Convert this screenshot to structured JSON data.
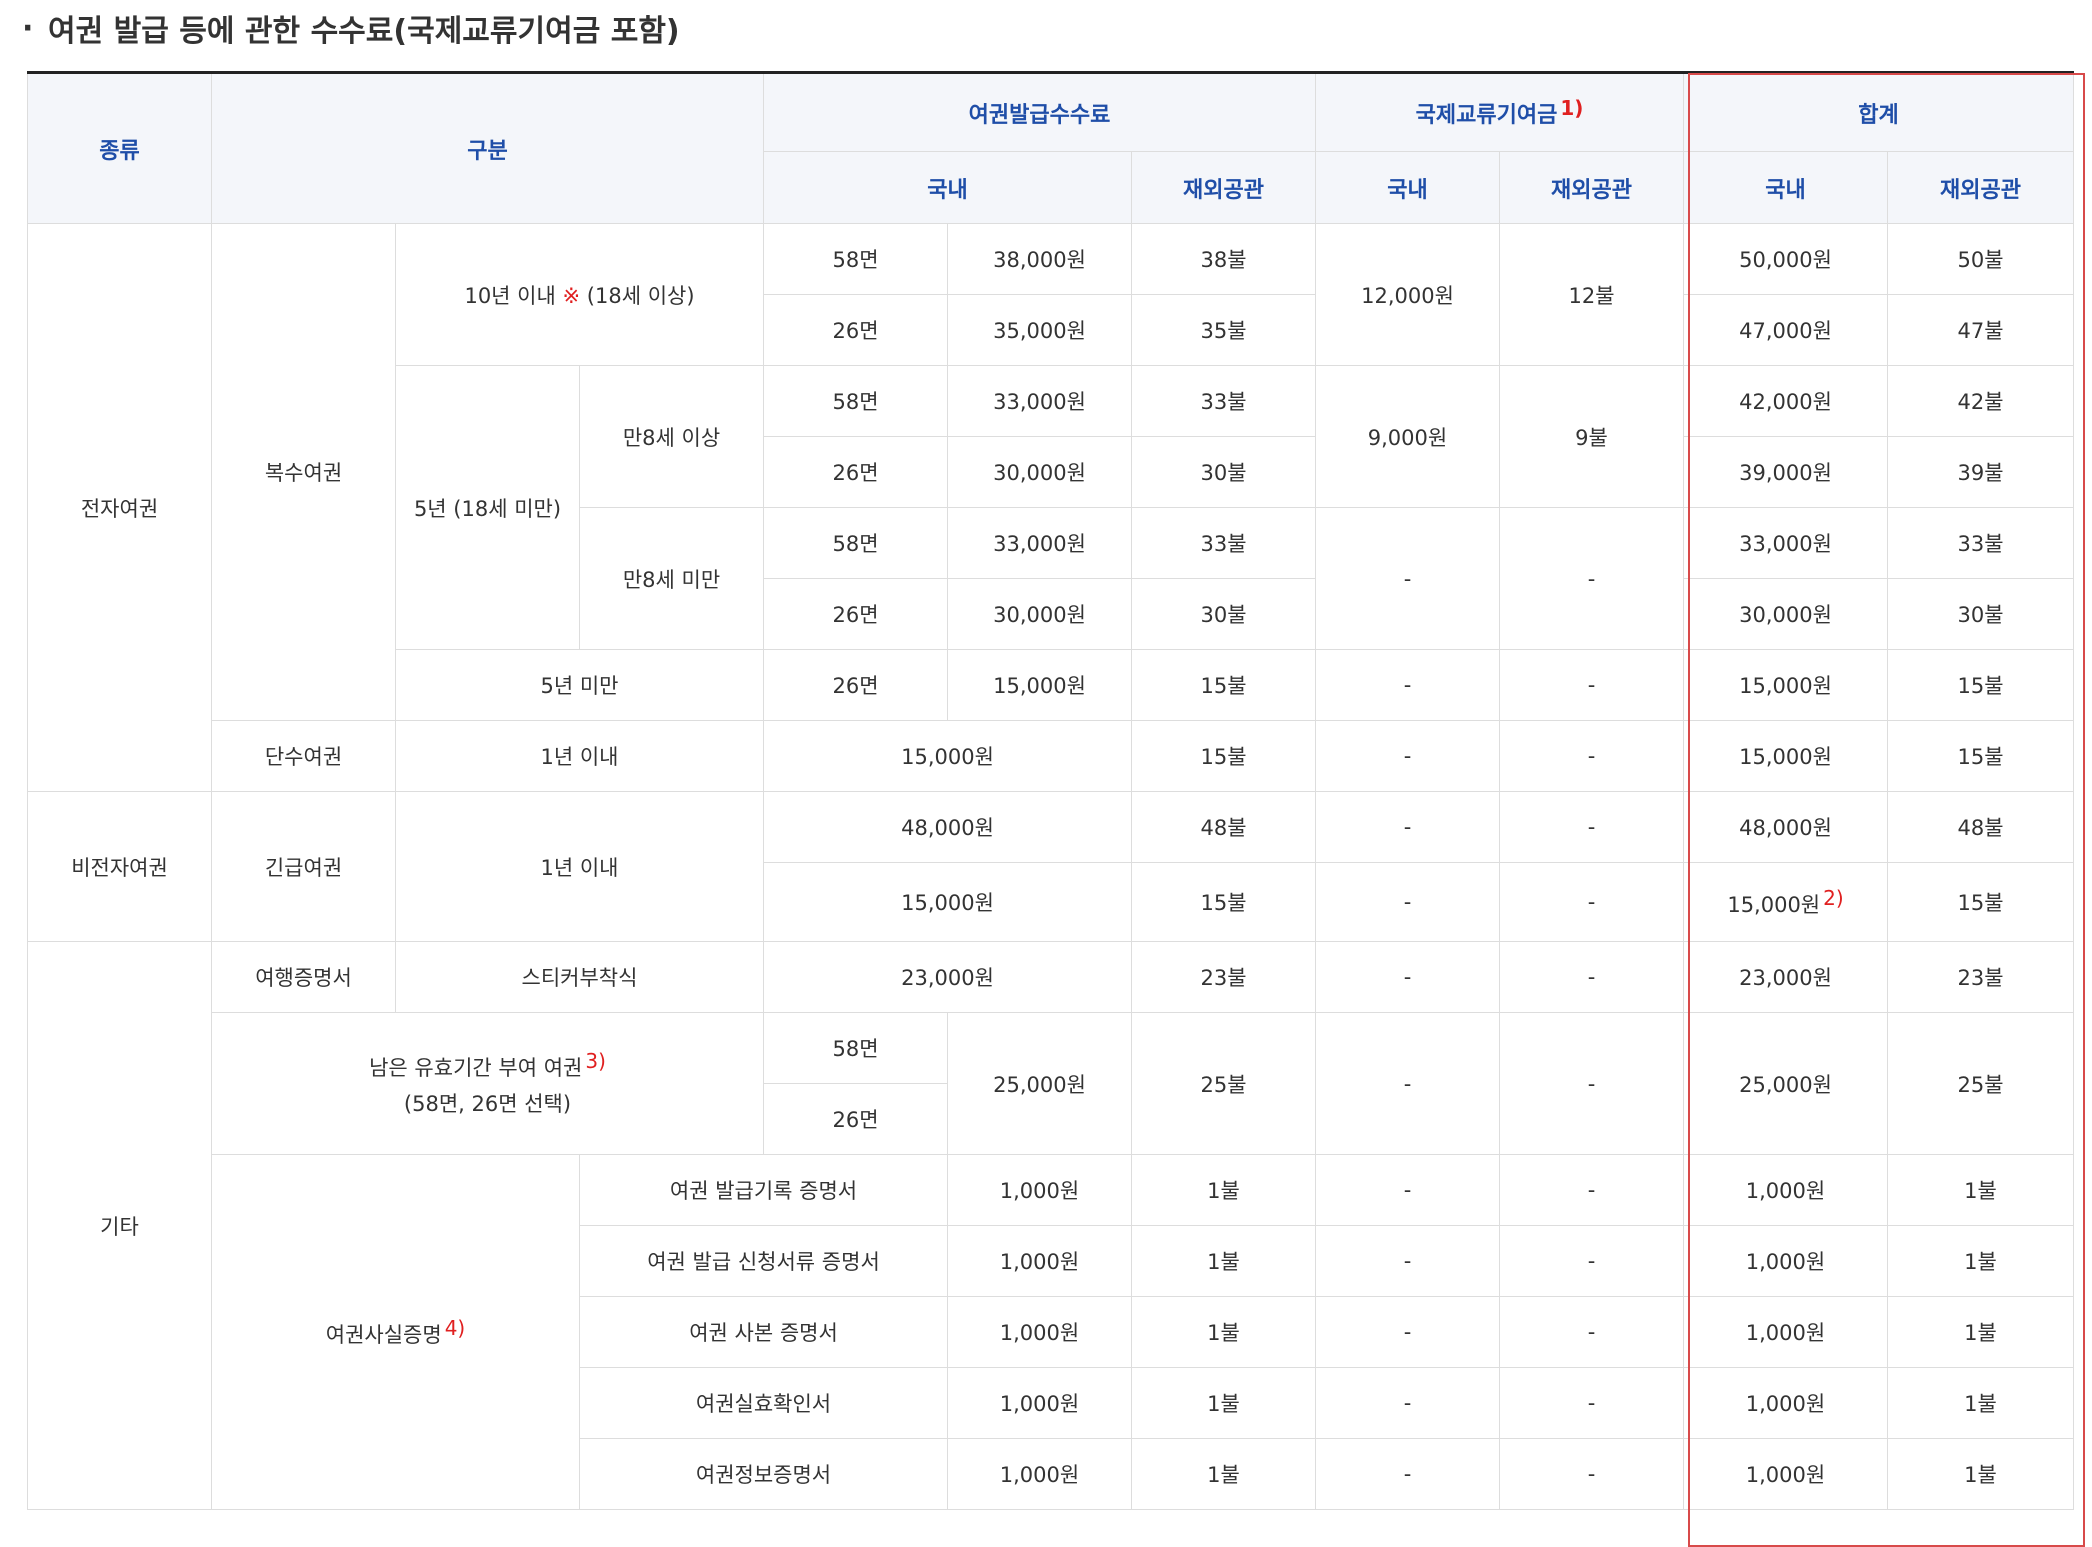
{
  "title": "여권 발급 등에 관한 수수료(국제교류기여금 포함)",
  "title_bullet": "·",
  "header": {
    "type": "종류",
    "category": "구분",
    "issuance_fee": "여권발급수수료",
    "contribution": "국제교류기여금",
    "contribution_note": "1)",
    "total": "합계",
    "domestic": "국내",
    "overseas": "재외공관"
  },
  "groups": {
    "electronic": "전자여권",
    "non_electronic": "비전자여권",
    "other": "기타"
  },
  "multi": {
    "label": "복수여권",
    "ten_year": "10년 이내",
    "ten_year_mark": "※",
    "ten_year_age": "(18세 이상)",
    "five_year": "5년 (18세 미만)",
    "age8_over": "만8세 이상",
    "age8_under": "만8세 미만",
    "under5": "5년 미만"
  },
  "pages": {
    "p58": "58면",
    "p26": "26면"
  },
  "rows": {
    "r1": {
      "dom": "38,000원",
      "ovs": "38불",
      "c_dom": "12,000원",
      "c_ovs": "12불",
      "t_dom": "50,000원",
      "t_ovs": "50불"
    },
    "r2": {
      "dom": "35,000원",
      "ovs": "35불",
      "t_dom": "47,000원",
      "t_ovs": "47불"
    },
    "r3": {
      "dom": "33,000원",
      "ovs": "33불",
      "c_dom": "9,000원",
      "c_ovs": "9불",
      "t_dom": "42,000원",
      "t_ovs": "42불"
    },
    "r4": {
      "dom": "30,000원",
      "ovs": "30불",
      "t_dom": "39,000원",
      "t_ovs": "39불"
    },
    "r5": {
      "dom": "33,000원",
      "ovs": "33불",
      "c_dom": "-",
      "c_ovs": "-",
      "t_dom": "33,000원",
      "t_ovs": "33불"
    },
    "r6": {
      "dom": "30,000원",
      "ovs": "30불",
      "t_dom": "30,000원",
      "t_ovs": "30불"
    },
    "r7": {
      "dom": "15,000원",
      "ovs": "15불",
      "c_dom": "-",
      "c_ovs": "-",
      "t_dom": "15,000원",
      "t_ovs": "15불"
    },
    "single": {
      "label": "단수여권",
      "period": "1년 이내",
      "dom": "15,000원",
      "ovs": "15불",
      "c_dom": "-",
      "c_ovs": "-",
      "t_dom": "15,000원",
      "t_ovs": "15불"
    },
    "emergency": {
      "label": "긴급여권",
      "period": "1년 이내"
    },
    "e1": {
      "dom": "48,000원",
      "ovs": "48불",
      "c_dom": "-",
      "c_ovs": "-",
      "t_dom": "48,000원",
      "t_ovs": "48불"
    },
    "e2": {
      "dom": "15,000원",
      "ovs": "15불",
      "c_dom": "-",
      "c_ovs": "-",
      "t_dom": "15,000원",
      "t_dom_note": "2)",
      "t_ovs": "15불"
    },
    "travel": {
      "label": "여행증명서",
      "type": "스티커부착식",
      "dom": "23,000원",
      "ovs": "23불",
      "c_dom": "-",
      "c_ovs": "-",
      "t_dom": "23,000원",
      "t_ovs": "23불"
    },
    "remaining": {
      "label": "남은 유효기간 부여 여권",
      "note": "3)",
      "sub": "(58면, 26면 선택)",
      "dom": "25,000원",
      "ovs": "25불",
      "c_dom": "-",
      "c_ovs": "-",
      "t_dom": "25,000원",
      "t_ovs": "25불"
    },
    "cert_label": "여권사실증명",
    "cert_note": "4)",
    "certs": [
      {
        "name": "여권 발급기록 증명서",
        "dom": "1,000원",
        "ovs": "1불",
        "c_dom": "-",
        "c_ovs": "-",
        "t_dom": "1,000원",
        "t_ovs": "1불"
      },
      {
        "name": "여권 발급 신청서류 증명서",
        "dom": "1,000원",
        "ovs": "1불",
        "c_dom": "-",
        "c_ovs": "-",
        "t_dom": "1,000원",
        "t_ovs": "1불"
      },
      {
        "name": "여권 사본 증명서",
        "dom": "1,000원",
        "ovs": "1불",
        "c_dom": "-",
        "c_ovs": "-",
        "t_dom": "1,000원",
        "t_ovs": "1불"
      },
      {
        "name": "여권실효확인서",
        "dom": "1,000원",
        "ovs": "1불",
        "c_dom": "-",
        "c_ovs": "-",
        "t_dom": "1,000원",
        "t_ovs": "1불"
      },
      {
        "name": "여권정보증명서",
        "dom": "1,000원",
        "ovs": "1불",
        "c_dom": "-",
        "c_ovs": "-",
        "t_dom": "1,000원",
        "t_ovs": "1불"
      }
    ]
  }
}
